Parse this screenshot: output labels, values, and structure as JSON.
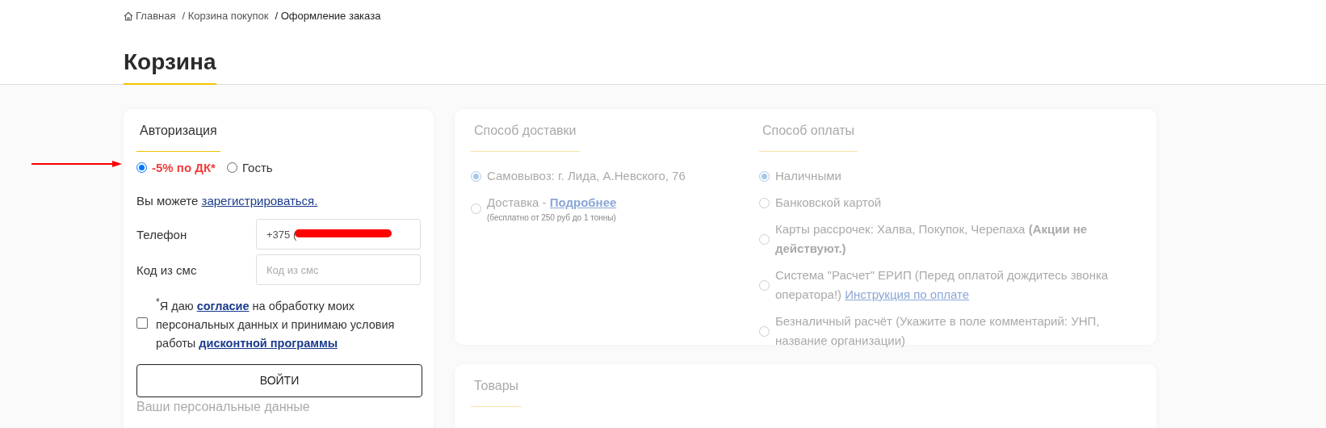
{
  "breadcrumbs": [
    {
      "label": "Главная",
      "kind": "home",
      "current": false
    },
    {
      "label": "/ Корзина покупок",
      "kind": "link",
      "current": false
    },
    {
      "label": "/ Оформление заказа",
      "kind": "link",
      "current": true
    }
  ],
  "page_title": "Корзина",
  "auth": {
    "title": "Авторизация",
    "modes": [
      {
        "label": "-5% по ДК*",
        "selected": true,
        "highlight": true
      },
      {
        "label": "Гость",
        "selected": false,
        "highlight": false
      }
    ],
    "register": {
      "text": "Вы можете",
      "link": "зарегистрироваться."
    },
    "fields": [
      {
        "label": "Телефон",
        "value": "+375 (",
        "redacted": true
      },
      {
        "label": "Код из смс",
        "placeholder": "Код из смс"
      }
    ],
    "consent": {
      "checked": false,
      "parts": [
        {
          "kind": "text",
          "text": "$^{*}$Я даю "
        },
        {
          "kind": "link",
          "text": "согласие"
        },
        {
          "kind": "text",
          "text": " на обработку моих персональных данных и принимаю условия работы "
        },
        {
          "kind": "link",
          "text": "дисконтной программы"
        }
      ]
    },
    "login_button": "ВОЙТИ",
    "next_heading": "Ваши персональные данные"
  },
  "options_card": {
    "disabled": true,
    "delivery": {
      "title": "Способ доставки",
      "options": [
        {
          "label": "Самовывоз: г. Лида, А.Невского, 76",
          "selected": true
        },
        {
          "label": "Доставка - ",
          "link": "Подробнее",
          "note": "(бесплатно от 250 руб до 1 тонны)",
          "selected": false
        }
      ]
    },
    "payment": {
      "title": "Способ оплаты",
      "options": [
        {
          "label": "Наличными",
          "selected": true
        },
        {
          "label": "Банковской картой",
          "selected": false
        },
        {
          "label": "Карты рассрочек: Халва, Покупок, Черепаха **(Акции не действуют.)**",
          "selected": false
        },
        {
          "label": "Система \"Расчет\" ЕРИП (Перед оплатой дождитесь звонка оператора!) ",
          "link": "Инструкция по оплате",
          "selected": false
        },
        {
          "label": "Безналичный расчёт (Укажите в поле комментарий: УНП, название организации)",
          "selected": false
        }
      ]
    }
  },
  "goods": {
    "title": "Товары"
  }
}
